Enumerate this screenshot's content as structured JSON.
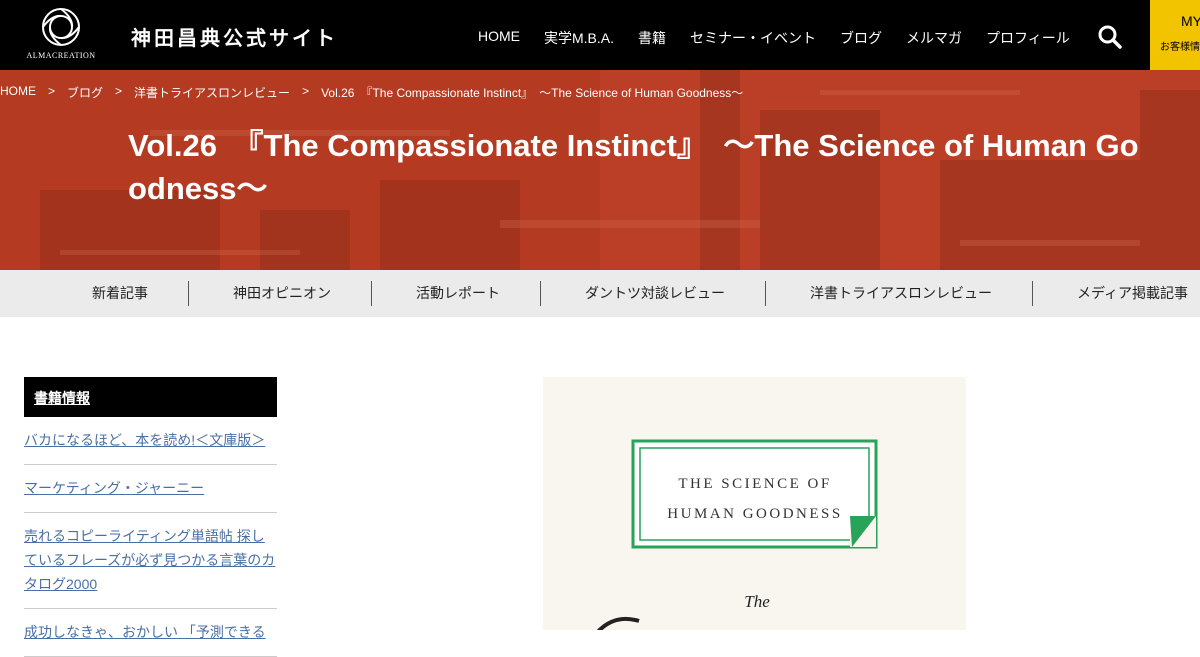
{
  "header": {
    "logo_text": "ALMACREATION",
    "site_title": "神田昌典公式サイト",
    "nav": [
      "HOME",
      "実学M.B.A.",
      "書籍",
      "セミナー・イベント",
      "ブログ",
      "メルマガ",
      "プロフィール"
    ],
    "my_label": "MY",
    "my_sub": "お客様情報"
  },
  "breadcrumb": [
    "HOME",
    "ブログ",
    "洋書トライアスロンレビュー",
    "Vol.26　『The Compassionate Instinct』　～The Science of Human Goodness～"
  ],
  "breadcrumb_sep": ">",
  "page_title": "Vol.26　『The Compassionate Instinct』　～The Science of Human Goodness～",
  "subnav": [
    "新着記事",
    "神田オピニオン",
    "活動レポート",
    "ダントツ対談レビュー",
    "洋書トライアスロンレビュー",
    "メディア掲載記事"
  ],
  "sidebar": {
    "heading": "書籍情報",
    "items": [
      "バカになるほど、本を読め!＜文庫版＞",
      "マーケティング・ジャーニー",
      "売れるコピーライティング単語帖 探しているフレーズが必ず見つかる言葉のカタログ2000",
      "成功しなきゃ、おかしい 「予測できる"
    ]
  },
  "book": {
    "label_line1": "THE SCIENCE OF",
    "label_line2": "HUMAN GOODNESS",
    "the": "The"
  },
  "colors": {
    "hero": "#b43a22",
    "accent_yellow": "#f2c400",
    "green": "#27a35a"
  }
}
